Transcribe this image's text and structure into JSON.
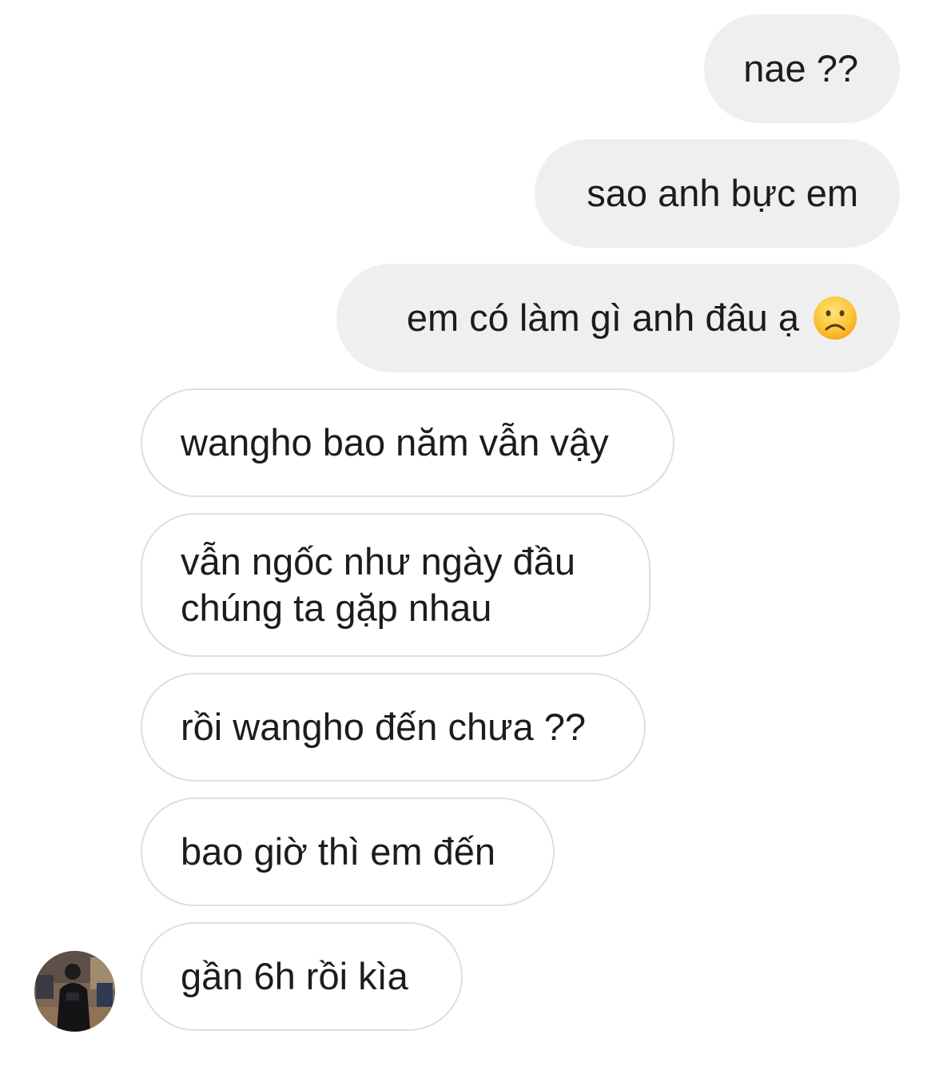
{
  "messages": {
    "sent": [
      {
        "text": "nae ??"
      },
      {
        "text": "sao anh bực em"
      },
      {
        "text": "em có làm gì anh đâu ạ",
        "emoji": "frowning-face-emoji"
      }
    ],
    "received": [
      {
        "text": "wangho bao năm vẫn vậy"
      },
      {
        "lines": [
          "vẫn ngốc như ngày đầu",
          "chúng ta gặp nhau"
        ]
      },
      {
        "text": "rồi wangho đến chưa ??"
      },
      {
        "text": "bao giờ thì em đến"
      },
      {
        "text": "gần 6h rồi kìa"
      }
    ]
  },
  "contact": {
    "avatar": "profile-photo"
  },
  "colors": {
    "sent_bubble": "#efefef",
    "received_border": "#dedede",
    "text": "#1c1c1c"
  }
}
